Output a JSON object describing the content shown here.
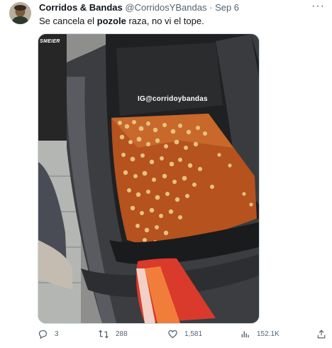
{
  "tweet": {
    "author": {
      "name": "Corridos & Bandas",
      "handle": "@CorridosYBandas",
      "separator": "·",
      "date": "Sep 6"
    },
    "more_label": "···",
    "text_before": "Se cancela el ",
    "text_bold": "pozole",
    "text_after": " raza, no vi el tope.",
    "media": {
      "watermark": "IG@corridoybandas",
      "brand_text": "SMEIER"
    },
    "actions": {
      "replies": "3",
      "reposts": "288",
      "likes": "1,581",
      "views": "152.1K"
    }
  },
  "colors": {
    "text_primary": "#0f1419",
    "text_secondary": "#536471",
    "border": "#cfd9de"
  },
  "icons": [
    "more-icon",
    "reply-icon",
    "repost-icon",
    "like-icon",
    "views-icon",
    "share-icon"
  ]
}
